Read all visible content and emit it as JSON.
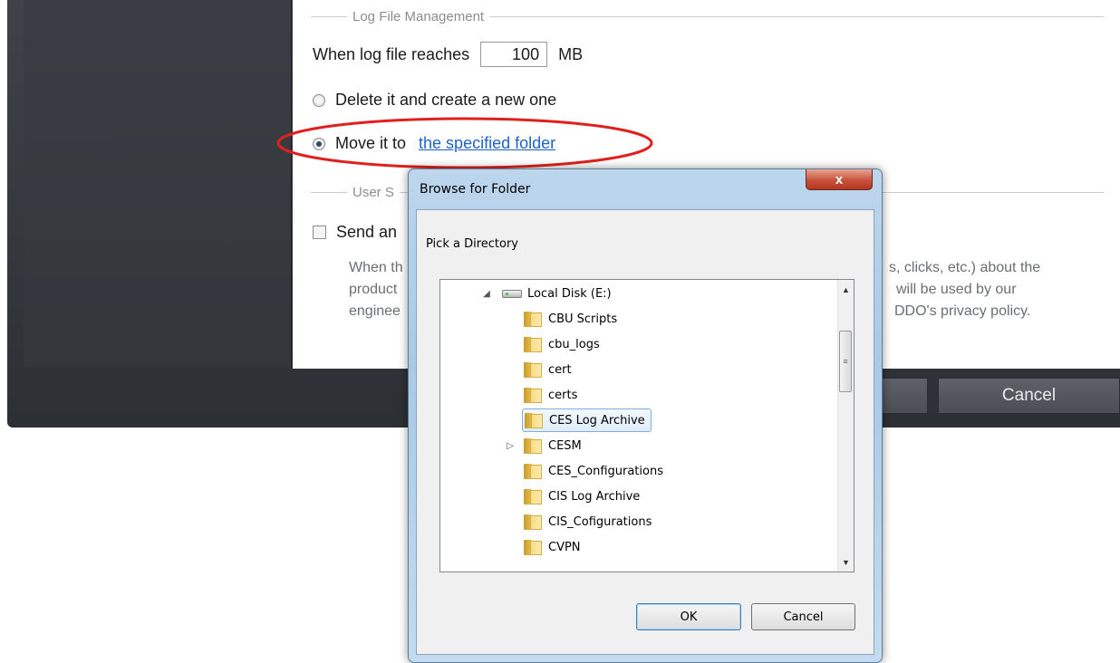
{
  "settings": {
    "log_group_title": "Log File Management",
    "when_label": "When log file reaches",
    "size_value": "100",
    "size_unit": "MB",
    "option_delete": "Delete it and create a new one",
    "option_move": "Move it to",
    "folder_link": "the specified folder",
    "user_group_title": "User S",
    "send_label": "Send an",
    "desc_line1_left": "When th",
    "desc_line1_right": "s, clicks, etc.) about the",
    "desc_line2_left": "product",
    "desc_line2_right": "will be used by our",
    "desc_line3_left": "enginee",
    "desc_line3_right": "DDO's privacy policy."
  },
  "bottom_bar": {
    "cancel_label": "Cancel"
  },
  "dialog": {
    "title": "Browse for Folder",
    "close_symbol": "x",
    "instruction": "Pick a Directory",
    "drive_label": "Local Disk (E:)",
    "folders": [
      "CBU Scripts",
      "cbu_logs",
      "cert",
      "certs",
      "CES Log Archive",
      "CESM",
      "CES_Configurations",
      "CIS Log Archive",
      "CIS_Cofigurations",
      "CVPN"
    ],
    "selected_folder": "CES Log Archive",
    "ok_label": "OK",
    "cancel_label": "Cancel"
  },
  "colors": {
    "annotation": "#e0201c",
    "link": "#1e62d0",
    "dark_panel": "#2c2f34"
  }
}
